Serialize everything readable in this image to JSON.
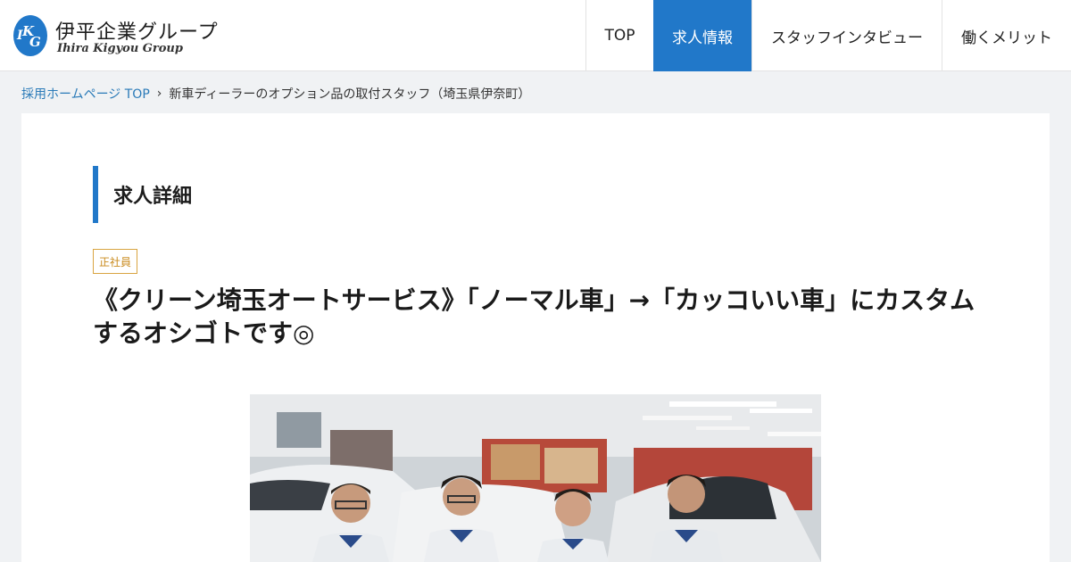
{
  "header": {
    "logo_name": "伊平企業グループ",
    "logo_sub": "Ihira Kigyou Group",
    "logo_mark": "IKG",
    "nav": [
      {
        "label": "TOP",
        "active": false
      },
      {
        "label": "求人情報",
        "active": true
      },
      {
        "label": "スタッフインタビュー",
        "active": false
      },
      {
        "label": "働くメリット",
        "active": false
      }
    ]
  },
  "breadcrumb": {
    "home": "採用ホームページ TOP",
    "separator": "›",
    "current": "新車ディーラーのオプション品の取付スタッフ（埼玉県伊奈町）"
  },
  "main": {
    "section_title": "求人詳細",
    "badge": "正社員",
    "job_title": "《クリーン埼玉オートサービス》「ノーマル車」→「カッコいい車」にカスタムするオシゴトです◎",
    "photo_alt": "staff-group-photo"
  },
  "colors": {
    "accent": "#2178c9",
    "badge": "#d9a441",
    "link": "#2a7ab8",
    "background": "#f0f2f4"
  }
}
